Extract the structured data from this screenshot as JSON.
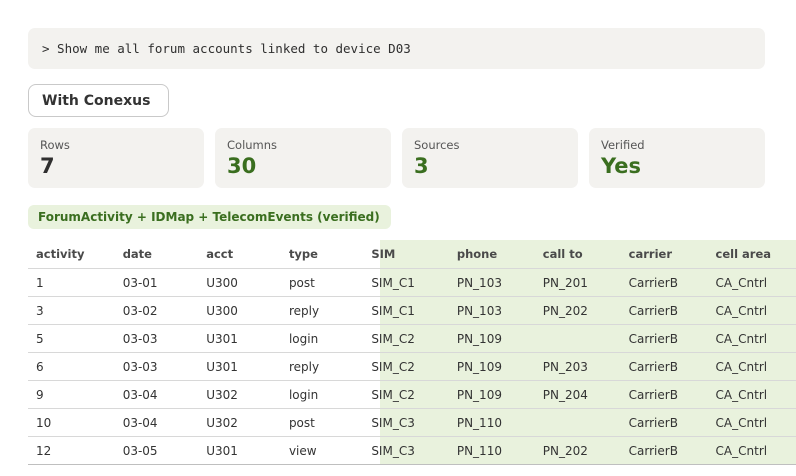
{
  "query": "> Show me all forum accounts linked to device D03",
  "mode_label": "With Conexus",
  "stats": [
    {
      "label": "Rows",
      "value": "7"
    },
    {
      "label": "Columns",
      "value": "30"
    },
    {
      "label": "Sources",
      "value": "3"
    },
    {
      "label": "Verified",
      "value": "Yes"
    }
  ],
  "source_badge": "ForumActivity + IDMap + TelecomEvents (verified)",
  "colors": {
    "accent": "#3a6e1f",
    "joined_bg": "#e9f2dd",
    "panel_bg": "#f3f2ef"
  },
  "table": {
    "headers": [
      "activity",
      "date",
      "acct",
      "type",
      "SIM",
      "phone",
      "call to",
      "carrier",
      "cell area"
    ],
    "rows": [
      [
        "1",
        "03-01",
        "U300",
        "post",
        "SIM_C1",
        "PN_103",
        "PN_201",
        "CarrierB",
        "CA_Cntrl"
      ],
      [
        "3",
        "03-02",
        "U300",
        "reply",
        "SIM_C1",
        "PN_103",
        "PN_202",
        "CarrierB",
        "CA_Cntrl"
      ],
      [
        "5",
        "03-03",
        "U301",
        "login",
        "SIM_C2",
        "PN_109",
        "",
        "CarrierB",
        "CA_Cntrl"
      ],
      [
        "6",
        "03-03",
        "U301",
        "reply",
        "SIM_C2",
        "PN_109",
        "PN_203",
        "CarrierB",
        "CA_Cntrl"
      ],
      [
        "9",
        "03-04",
        "U302",
        "login",
        "SIM_C2",
        "PN_109",
        "PN_204",
        "CarrierB",
        "CA_Cntrl"
      ],
      [
        "10",
        "03-04",
        "U302",
        "post",
        "SIM_C3",
        "PN_110",
        "",
        "CarrierB",
        "CA_Cntrl"
      ],
      [
        "12",
        "03-05",
        "U301",
        "view",
        "SIM_C3",
        "PN_110",
        "PN_202",
        "CarrierB",
        "CA_Cntrl"
      ]
    ]
  }
}
